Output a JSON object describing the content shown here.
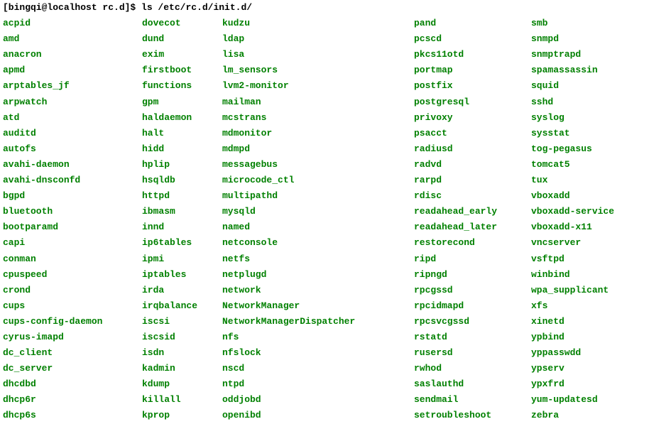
{
  "prompt": "[bingqi@localhost rc.d]$ ls /etc/rc.d/init.d/",
  "columns": [
    [
      "acpid",
      "amd",
      "anacron",
      "apmd",
      "arptables_jf",
      "arpwatch",
      "atd",
      "auditd",
      "autofs",
      "avahi-daemon",
      "avahi-dnsconfd",
      "bgpd",
      "bluetooth",
      "bootparamd",
      "capi",
      "conman",
      "cpuspeed",
      "crond",
      "cups",
      "cups-config-daemon",
      "cyrus-imapd",
      "dc_client",
      "dc_server",
      "dhcdbd",
      "dhcp6r",
      "dhcp6s"
    ],
    [
      "dovecot",
      "dund",
      "exim",
      "firstboot",
      "functions",
      "gpm",
      "haldaemon",
      "halt",
      "hidd",
      "hplip",
      "hsqldb",
      "httpd",
      "ibmasm",
      "innd",
      "ip6tables",
      "ipmi",
      "iptables",
      "irda",
      "irqbalance",
      "iscsi",
      "iscsid",
      "isdn",
      "kadmin",
      "kdump",
      "killall",
      "kprop"
    ],
    [
      "kudzu",
      "ldap",
      "lisa",
      "lm_sensors",
      "lvm2-monitor",
      "mailman",
      "mcstrans",
      "mdmonitor",
      "mdmpd",
      "messagebus",
      "microcode_ctl",
      "multipathd",
      "mysqld",
      "named",
      "netconsole",
      "netfs",
      "netplugd",
      "network",
      "NetworkManager",
      "NetworkManagerDispatcher",
      "nfs",
      "nfslock",
      "nscd",
      "ntpd",
      "oddjobd",
      "openibd"
    ],
    [
      "pand",
      "pcscd",
      "pkcs11otd",
      "portmap",
      "postfix",
      "postgresql",
      "privoxy",
      "psacct",
      "radiusd",
      "radvd",
      "rarpd",
      "rdisc",
      "readahead_early",
      "readahead_later",
      "restorecond",
      "ripd",
      "ripngd",
      "rpcgssd",
      "rpcidmapd",
      "rpcsvcgssd",
      "rstatd",
      "rusersd",
      "rwhod",
      "saslauthd",
      "sendmail",
      "setroubleshoot"
    ],
    [
      "smb",
      "snmpd",
      "snmptrapd",
      "spamassassin",
      "squid",
      "sshd",
      "syslog",
      "sysstat",
      "tog-pegasus",
      "tomcat5",
      "tux",
      "vboxadd",
      "vboxadd-service",
      "vboxadd-x11",
      "vncserver",
      "vsftpd",
      "winbind",
      "wpa_supplicant",
      "xfs",
      "xinetd",
      "ypbind",
      "yppasswdd",
      "ypserv",
      "ypxfrd",
      "yum-updatesd",
      "zebra"
    ]
  ]
}
